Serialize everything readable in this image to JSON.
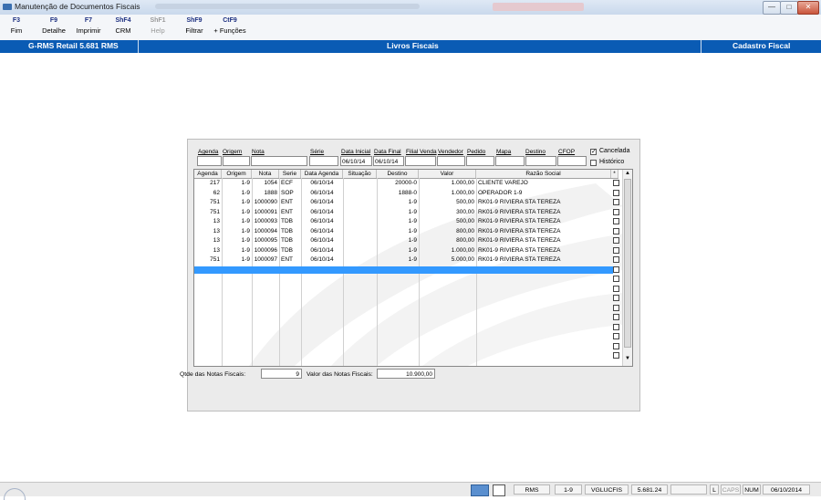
{
  "window": {
    "title": "Manutenção de Documentos Fiscais",
    "controls": [
      "—",
      "□",
      "✕"
    ]
  },
  "toolbar": [
    {
      "key": "F3",
      "label": "Fim",
      "enabled": true
    },
    {
      "key": "F9",
      "label": "Detalhe",
      "enabled": true
    },
    {
      "key": "F7",
      "label": "Imprimir",
      "enabled": true
    },
    {
      "key": "ShF4",
      "label": "CRM",
      "enabled": true
    },
    {
      "key": "ShF1",
      "label": "Help",
      "enabled": false
    },
    {
      "key": "ShF9",
      "label": "Filtrar",
      "enabled": true
    },
    {
      "key": "CtF9",
      "label": "+ Funções",
      "enabled": true
    }
  ],
  "header": {
    "left": "G-RMS Retail 5.681 RMS",
    "center": "Livros Fiscais",
    "right": "Cadastro Fiscal"
  },
  "filters": {
    "labels": {
      "agenda": "Agenda",
      "origem": "Origem",
      "nota": "Nota",
      "serie": "Série",
      "data_inicial": "Data Inicial",
      "data_final": "Data Final",
      "filial_venda": "Filial Venda",
      "vendedor": "Vendedor",
      "pedido": "Pedido",
      "mapa": "Mapa",
      "destino": "Destino",
      "cfop": "CFOP"
    },
    "values": {
      "data_inicial": "06/10/14",
      "data_final": "06/10/14"
    },
    "cancelada_label": "Cancelada",
    "cancelada_checked": "✓",
    "historico_label": "Histórico"
  },
  "table": {
    "columns": [
      "Agenda",
      "Origem",
      "Nota",
      "Serie",
      "Data Agenda",
      "Situação",
      "Destino",
      "Valor",
      "Razão Social",
      "*"
    ],
    "rows": [
      [
        "217",
        "1-9",
        "1054",
        "ECF",
        "06/10/14",
        "",
        "20000-0",
        "1.000,00",
        "CLIENTE VAREJO"
      ],
      [
        "62",
        "1-9",
        "1888",
        "SOP",
        "06/10/14",
        "",
        "1888-0",
        "1.000,00",
        "OPERADOR 1-9"
      ],
      [
        "751",
        "1-9",
        "1000090",
        "ENT",
        "06/10/14",
        "",
        "1-9",
        "500,00",
        "RK01-9 RIVIERA STA TEREZA"
      ],
      [
        "751",
        "1-9",
        "1000091",
        "ENT",
        "06/10/14",
        "",
        "1-9",
        "300,00",
        "RK01-9 RIVIERA STA TEREZA"
      ],
      [
        "13",
        "1-9",
        "1000093",
        "TDB",
        "06/10/14",
        "",
        "1-9",
        "500,00",
        "RK01-9 RIVIERA STA TEREZA"
      ],
      [
        "13",
        "1-9",
        "1000094",
        "TDB",
        "06/10/14",
        "",
        "1-9",
        "800,00",
        "RK01-9 RIVIERA STA TEREZA"
      ],
      [
        "13",
        "1-9",
        "1000095",
        "TDB",
        "06/10/14",
        "",
        "1-9",
        "800,00",
        "RK01-9 RIVIERA STA TEREZA"
      ],
      [
        "13",
        "1-9",
        "1000096",
        "TDB",
        "06/10/14",
        "",
        "1-9",
        "1.000,00",
        "RK01-9 RIVIERA STA TEREZA"
      ],
      [
        "751",
        "1-9",
        "1000097",
        "ENT",
        "06/10/14",
        "",
        "1-9",
        "5.000,00",
        "RK01-9 RIVIERA STA TEREZA"
      ]
    ]
  },
  "totals": {
    "qtde_label": "Qtde das Notas Fiscais:",
    "qtde_value": "9",
    "valor_label": "Valor  das Notas Fiscais:",
    "valor_value": "10.900,00"
  },
  "statusbar": [
    "RMS",
    "1-9",
    "VGLUCFIS",
    "5.681.24",
    "",
    "L",
    "CAPS",
    "NUM",
    "06/10/2014"
  ],
  "colors": {
    "header_blue": "#0a5bb4",
    "selection": "#3399ff",
    "toolbar_key": "#1c2f80"
  }
}
